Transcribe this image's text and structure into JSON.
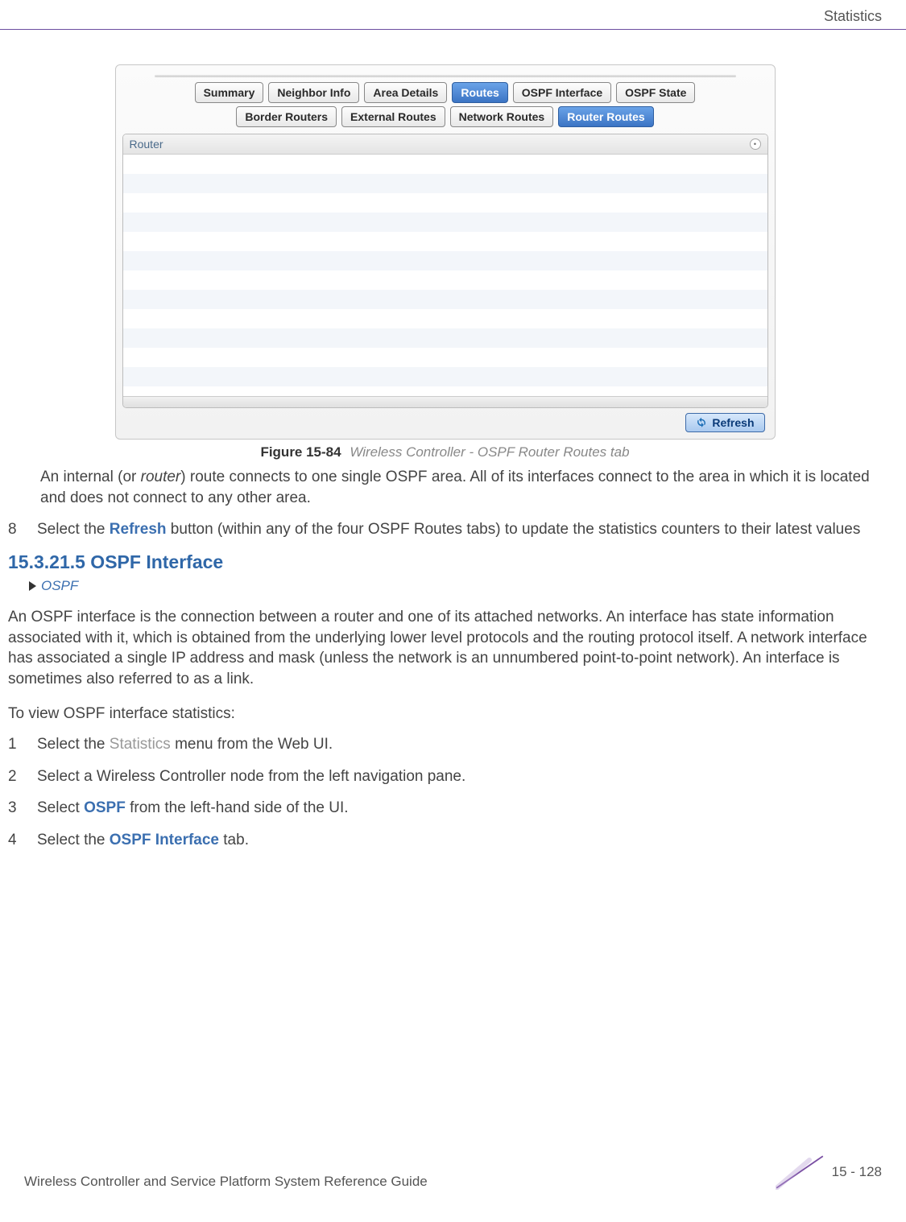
{
  "header": {
    "section": "Statistics"
  },
  "figure": {
    "tabs_row1": [
      {
        "label": "Summary",
        "active": false
      },
      {
        "label": "Neighbor Info",
        "active": false
      },
      {
        "label": "Area Details",
        "active": false
      },
      {
        "label": "Routes",
        "active": true
      },
      {
        "label": "OSPF Interface",
        "active": false
      },
      {
        "label": "OSPF State",
        "active": false
      }
    ],
    "tabs_row2": [
      {
        "label": "Border Routers",
        "active": false
      },
      {
        "label": "External Routes",
        "active": false
      },
      {
        "label": "Network Routes",
        "active": false
      },
      {
        "label": "Router Routes",
        "active": true
      }
    ],
    "table_header": "Router",
    "refresh_label": "Refresh",
    "caption_num": "Figure 15-84",
    "caption_title": "Wireless Controller - OSPF Router Routes tab"
  },
  "body": {
    "p_internal_1": "An internal (or ",
    "p_internal_em": "router",
    "p_internal_2": ") route connects to one single OSPF area. All of its interfaces connect to the area in which it is located and does not connect to any other area.",
    "step8_num": "8",
    "step8_a": "Select the ",
    "step8_refresh": "Refresh",
    "step8_b": " button (within any of the four OSPF Routes tabs) to update the statistics counters to their latest values",
    "section_num_title": "15.3.21.5  OSPF Interface",
    "breadcrumb": "OSPF",
    "p_intro": "An OSPF interface is the connection between a router and one of its attached networks. An interface has state information associated with it, which is obtained from the underlying lower level protocols and the routing protocol itself. A network interface has associated a single IP address and mask (unless the network is an unnumbered point-to-point network). An interface is sometimes also referred to as a link.",
    "p_toview": "To view OSPF interface statistics:",
    "s1_num": "1",
    "s1_a": "Select the ",
    "s1_stat": "Statistics",
    "s1_b": " menu from the Web UI.",
    "s2_num": "2",
    "s2_text": "Select a Wireless Controller node from the left navigation pane.",
    "s3_num": "3",
    "s3_a": "Select ",
    "s3_ospf": "OSPF",
    "s3_b": " from the left-hand side of the UI.",
    "s4_num": "4",
    "s4_a": "Select the ",
    "s4_tab": "OSPF Interface",
    "s4_b": " tab."
  },
  "footer": {
    "left": "Wireless Controller and Service Platform System Reference Guide",
    "right": "15 - 128"
  }
}
